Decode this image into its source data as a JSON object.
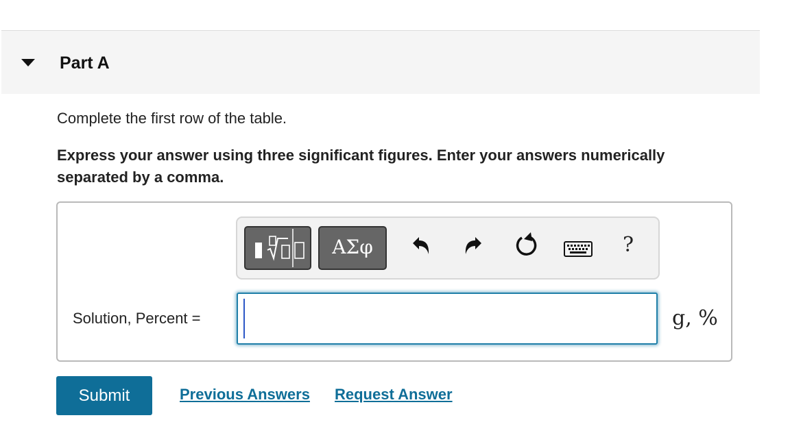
{
  "part": {
    "title": "Part A"
  },
  "question": {
    "prompt": "Complete the first row of the table.",
    "instructions": "Express your answer using three significant figures. Enter your answers numerically separated by a comma."
  },
  "toolbar": {
    "symbols_label": "ΑΣφ",
    "help_label": "?",
    "icons": [
      "templates-icon",
      "greek-symbols-icon",
      "undo-icon",
      "redo-icon",
      "reset-icon",
      "keyboard-icon",
      "help-icon"
    ]
  },
  "answer": {
    "label": "Solution, Percent =",
    "value": "",
    "units": "g, %"
  },
  "actions": {
    "submit_label": "Submit",
    "previous_answers_label": "Previous Answers",
    "request_answer_label": "Request Answer"
  },
  "colors": {
    "accent": "#0f6e98",
    "header_bg": "#f5f5f5",
    "toolbar_button": "#666666"
  }
}
